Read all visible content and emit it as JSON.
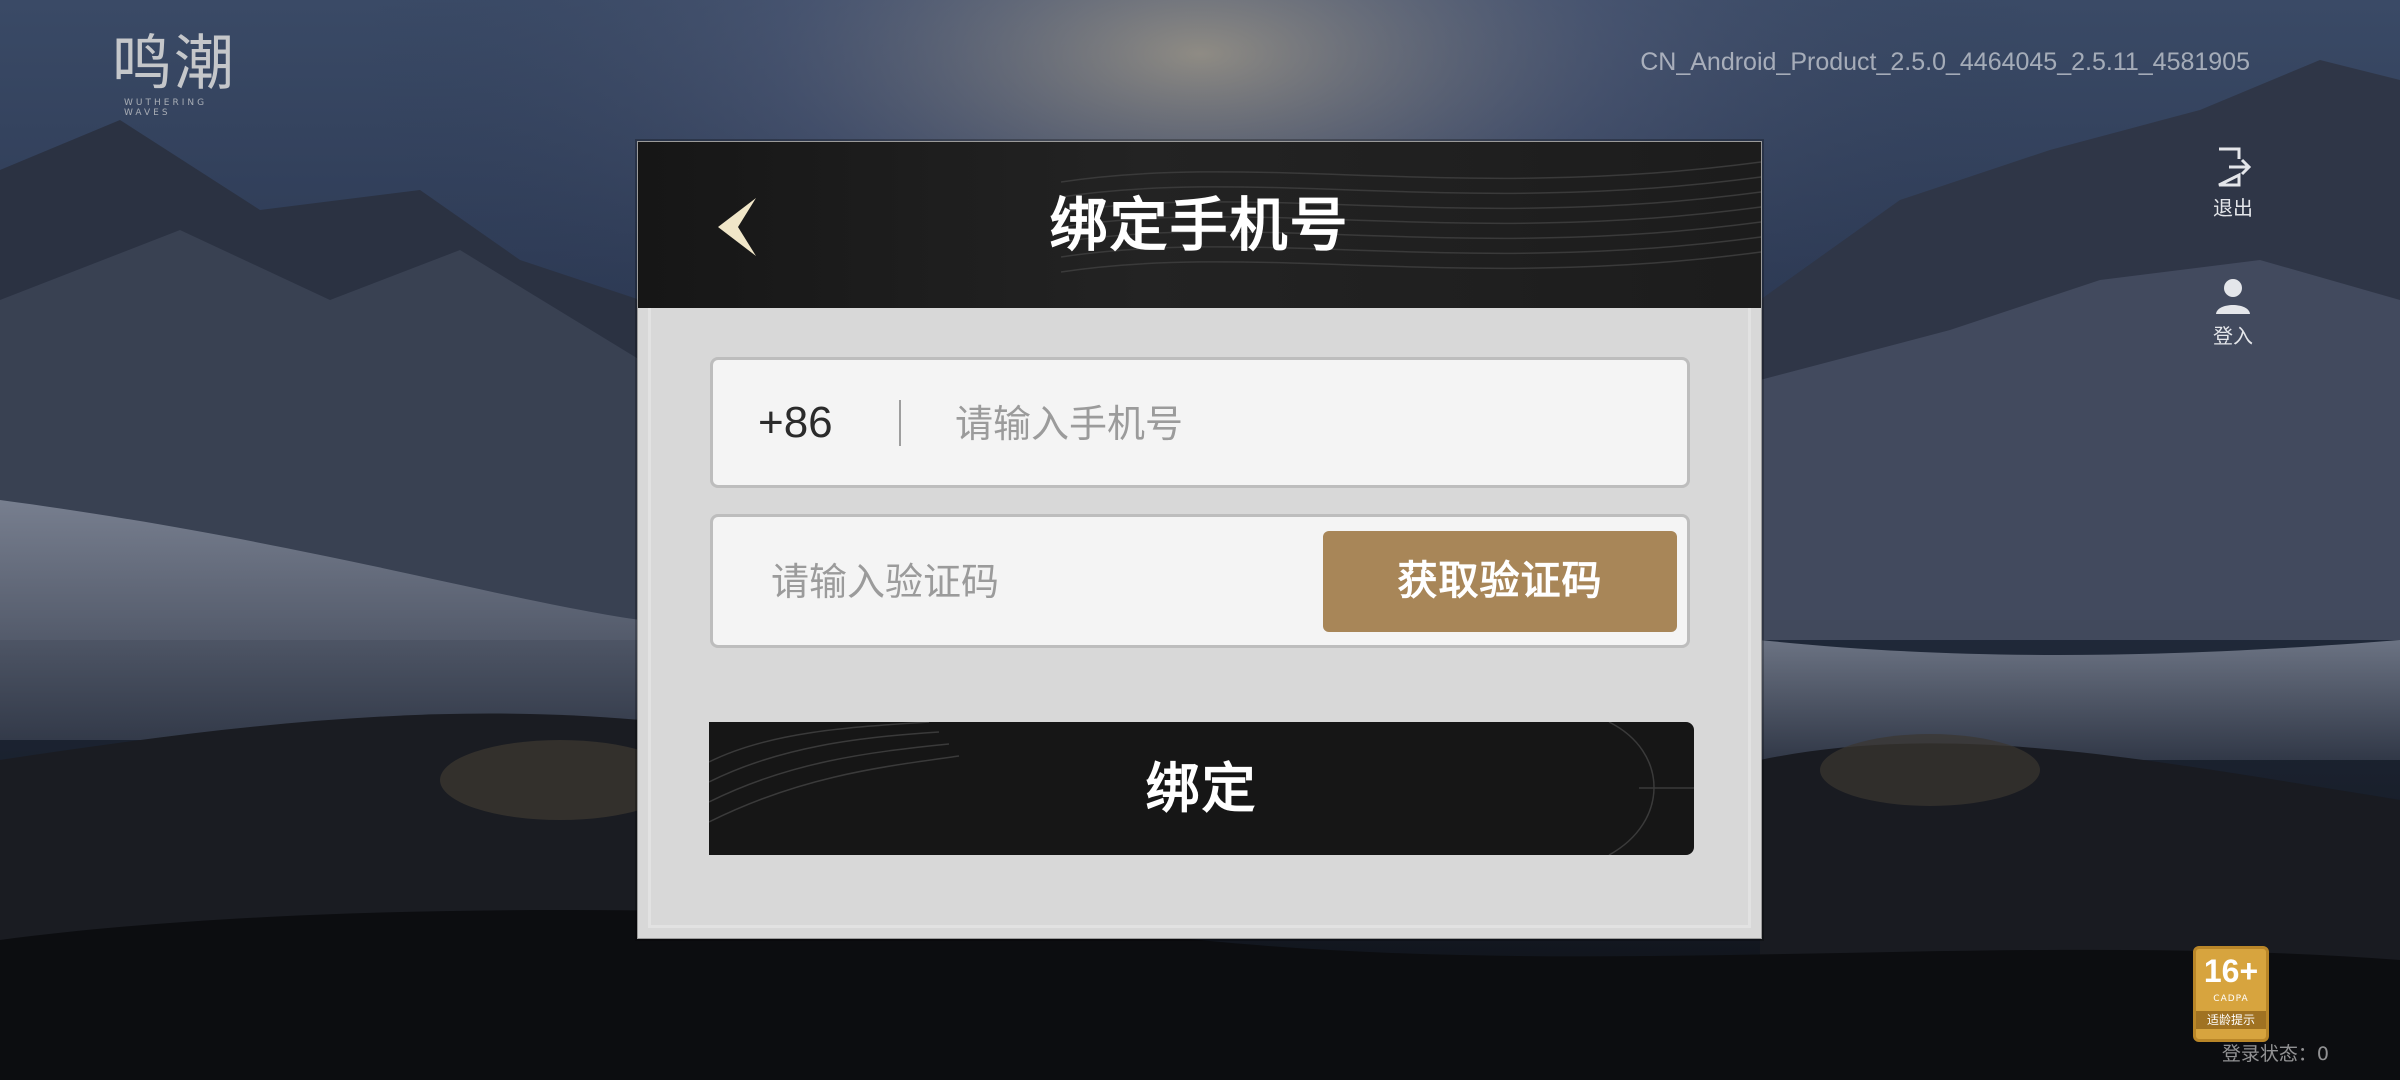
{
  "app": {
    "logo_text": "鸣潮",
    "logo_subtext": "WUTHERING WAVES",
    "version": "CN_Android_Product_2.5.0_4464045_2.5.11_4581905"
  },
  "side_menu": {
    "exit_label": "退出",
    "login_label": "登入"
  },
  "dialog": {
    "title": "绑定手机号",
    "phone": {
      "prefix": "+86",
      "placeholder": "请输入手机号",
      "value": ""
    },
    "code": {
      "placeholder": "请输入验证码",
      "value": "",
      "get_code_label": "获取验证码"
    },
    "bind_label": "绑定"
  },
  "age_rating": {
    "age": "16+",
    "org": "CADPA",
    "tip": "适龄提示"
  },
  "login_status": "登录状态：0",
  "colors": {
    "accent_gold": "#a88658",
    "dark_button": "#161616",
    "dialog_bg": "#d8d8d8"
  }
}
